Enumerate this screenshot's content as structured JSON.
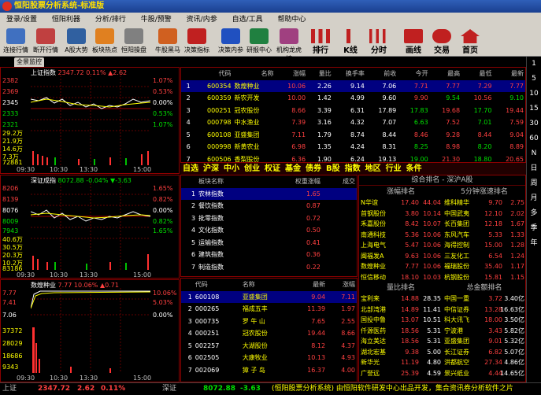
{
  "title": "恒阳股票分析系统-标准版",
  "menu": [
    "登录/设置",
    "恒阳利器",
    "分析/排行",
    "牛股/预警",
    "资讯/内参",
    "自选/工具",
    "帮助中心"
  ],
  "toolbar": [
    "连接行情",
    "断开行情",
    "A股大势",
    "板块热点",
    "恒阳操盘",
    "牛股黑马",
    "决策指标",
    "决策内参",
    "研报中心",
    "机构龙虎榜"
  ],
  "toolbar_big": [
    "排行",
    "K线",
    "分时",
    "画线",
    "交易",
    "首页"
  ],
  "tab_label": "全景监控",
  "right_bar": [
    "1",
    "5",
    "10",
    "15",
    "30",
    "60",
    "N",
    "日",
    "周",
    "月",
    "多",
    "季",
    "年"
  ],
  "chart1": {
    "name": "上证指数",
    "value": "2347.72",
    "pct": "0.11%",
    "chg": "▲2.62",
    "left_ticks": [
      "2382",
      "2369",
      "2345",
      "2333",
      "2321"
    ],
    "right_ticks": [
      "1.07%",
      "0.53%",
      "0.00%",
      "0.53%",
      "1.07%"
    ],
    "vol_ticks": [
      "29.2万",
      "21.9万",
      "14.6万",
      "7.3万"
    ],
    "vol_last": "72881",
    "time_axis": [
      "09:30",
      "10:30",
      "13:30",
      "15:00"
    ]
  },
  "chart2": {
    "name": "深证成指",
    "value": "8072.88",
    "pct": "-0.04%",
    "chg": "▼-3.63",
    "left_ticks": [
      "8206",
      "8139",
      "8076",
      "8009",
      "7943"
    ],
    "right_ticks": [
      "1.65%",
      "0.82%",
      "0.00%",
      "0.82%",
      "1.65%"
    ],
    "vol_ticks": [
      "40.6万",
      "30.5万",
      "20.3万",
      "10.2万"
    ],
    "vol_last": "83186",
    "time_axis": [
      "09:30",
      "10:30",
      "13:30",
      "15:00"
    ]
  },
  "chart3": {
    "name": "数煌种业",
    "value": "7.77",
    "pct": "10.06%",
    "chg": "▲0.71",
    "left_ticks": [
      "7.77",
      "7.41",
      "7.06"
    ],
    "right_ticks": [
      "10.06%",
      "5.03%",
      "0.00%"
    ],
    "vol_ticks": [
      "37372",
      "28029",
      "18686",
      "9343"
    ],
    "time_axis": [
      "09:30",
      "10:30",
      "13:30",
      "15:00"
    ]
  },
  "quote_table": {
    "headers": [
      "代码",
      "名称",
      "涨幅",
      "量比",
      "换手率",
      "前收",
      "今开",
      "最高",
      "最低",
      "最新"
    ],
    "rows": [
      [
        "1",
        "600354",
        "数煌种业",
        "10.06",
        "2.26",
        "9.14",
        "7.06",
        "7.71",
        "7.77",
        "7.29",
        "7.77"
      ],
      [
        "2",
        "600359",
        "新农开发",
        "10.00",
        "1.42",
        "4.99",
        "9.60",
        "9.90",
        "9.54",
        "10.56",
        "9.10"
      ],
      [
        "3",
        "000251",
        "冠农股份",
        "8.66",
        "3.39",
        "6.31",
        "17.89",
        "17.83",
        "19.68",
        "17.70",
        "19.44"
      ],
      [
        "4",
        "000798",
        "中水渔业",
        "7.39",
        "3.16",
        "4.32",
        "7.07",
        "6.63",
        "7.52",
        "7.01",
        "7.59"
      ],
      [
        "5",
        "600108",
        "亚盛集团",
        "7.11",
        "1.79",
        "8.74",
        "8.44",
        "8.46",
        "9.28",
        "8.44",
        "9.04"
      ],
      [
        "6",
        "000998",
        "新黄农业",
        "6.98",
        "1.35",
        "4.24",
        "8.31",
        "8.25",
        "8.98",
        "8.20",
        "8.89"
      ],
      [
        "7",
        "600506",
        "香梨股份",
        "6.36",
        "1.90",
        "6.24",
        "19.13",
        "19.00",
        "21.30",
        "18.80",
        "20.65"
      ]
    ]
  },
  "category_bar": [
    "自选",
    "沪深",
    "中小",
    "创业",
    "权证",
    "基金",
    "债券",
    "B股",
    "指数",
    "地区",
    "行业",
    "条件"
  ],
  "sector_table": {
    "headers": [
      "板块名称",
      "权重涨幅",
      "成交"
    ],
    "rows": [
      [
        "1",
        "农林指数",
        "1.65"
      ],
      [
        "2",
        "餐饮指数",
        "0.87"
      ],
      [
        "3",
        "批零指数",
        "0.72"
      ],
      [
        "4",
        "文化指数",
        "0.50"
      ],
      [
        "5",
        "运输指数",
        "0.41"
      ],
      [
        "6",
        "建筑指数",
        "0.36"
      ],
      [
        "7",
        "制造指数",
        "0.22"
      ]
    ]
  },
  "stock_table": {
    "headers": [
      "代码",
      "名称",
      "最新",
      "涨幅"
    ],
    "rows": [
      [
        "1",
        "600108",
        "亚盛集团",
        "9.04",
        "7.11"
      ],
      [
        "2",
        "000265",
        "福成五丰",
        "11.39",
        "1.97"
      ],
      [
        "3",
        "000735",
        "罗 牛 山",
        "7.65",
        "2.55"
      ],
      [
        "4",
        "000251",
        "冠农股份",
        "19.44",
        "8.66"
      ],
      [
        "5",
        "002257",
        "大湖股份",
        "8.12",
        "4.37"
      ],
      [
        "6",
        "002505",
        "大康牧业",
        "10.13",
        "4.93"
      ],
      [
        "7",
        "002069",
        "獐 子 岛",
        "16.37",
        "4.00"
      ]
    ]
  },
  "rank_panel": {
    "title": "综合排名 - 深沪A股",
    "rise": {
      "title": "涨幅排名",
      "rows": [
        [
          "N华谊",
          "17.40",
          "44.04"
        ],
        [
          "首钢股份",
          "3.80",
          "10.14"
        ],
        [
          "禾嘉股份",
          "8.42",
          "10.07"
        ],
        [
          "南通科技",
          "5.36",
          "10.06"
        ],
        [
          "上海电气",
          "5.47",
          "10.06"
        ],
        [
          "闽福发A",
          "9.63",
          "10.06"
        ],
        [
          "数煌种业",
          "7.77",
          "10.06"
        ],
        [
          "恒信移动",
          "18.10",
          "10.03"
        ]
      ]
    },
    "speed": {
      "title": "5分钟涨速排名",
      "rows": [
        [
          "维科精华",
          "9.70",
          "2.75"
        ],
        [
          "中国武夷",
          "12.10",
          "2.02"
        ],
        [
          "长百集团",
          "12.18",
          "1.67"
        ],
        [
          "东风汽车",
          "5.33",
          "1.33"
        ],
        [
          "海得控制",
          "15.00",
          "1.28"
        ],
        [
          "三友化工",
          "6.54",
          "1.24"
        ],
        [
          "福瑞股份",
          "35.40",
          "1.17"
        ],
        [
          "杭钢股份",
          "15.81",
          "1.15"
        ]
      ]
    },
    "volratio": {
      "title": "量比排名",
      "rows": [
        [
          "宝利来",
          "14.88",
          "28.35"
        ],
        [
          "北部湾港",
          "14.89",
          "11.41"
        ],
        [
          "国投中鲁",
          "13.07",
          "10.51"
        ],
        [
          "仟源医药",
          "18.56",
          "5.31"
        ],
        [
          "海立美达",
          "18.56",
          "5.31"
        ],
        [
          "湖北宏基",
          "9.38",
          "5.00"
        ],
        [
          "新华光",
          "11.19",
          "4.80"
        ],
        [
          "广誉远",
          "25.39",
          "4.59"
        ]
      ]
    },
    "amount": {
      "title": "总金额排名",
      "rows": [
        [
          "中国一重",
          "3.72",
          "3.40亿"
        ],
        [
          "中信证券",
          "13.28",
          "16.63亿"
        ],
        [
          "科大讯飞",
          "18.00",
          "3.50亿"
        ],
        [
          "宁波港",
          "3.43",
          "5.82亿"
        ],
        [
          "亚盛集团",
          "9.01",
          "5.32亿"
        ],
        [
          "长江证券",
          "6.82",
          "5.07亿"
        ],
        [
          "洪都航空",
          "27.34",
          "4.86亿"
        ],
        [
          "景兴纸业",
          "4.44",
          "14.65亿"
        ]
      ]
    }
  },
  "status": {
    "sh_label": "上证",
    "sh_val": "2347.72",
    "sh_chg": "2.62",
    "sh_pct": "0.11%",
    "sz_label": "深证",
    "sz_val": "8072.88",
    "sz_chg": "-3.63",
    "ticker": "(恒阳股票分析系统) 由恒阳软件研发中心出品开发，集合资讯券分析软件之片"
  }
}
